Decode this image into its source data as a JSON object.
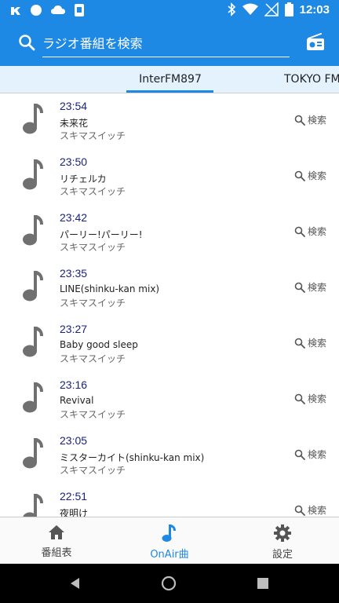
{
  "status_bar": {
    "time": "12:03"
  },
  "search": {
    "placeholder": "ラジオ番組を検索"
  },
  "tabs": [
    {
      "label": "InterFM897"
    },
    {
      "label": "TOKYO FM"
    }
  ],
  "songs": [
    {
      "time": "23:54",
      "title": "未来花",
      "artist": "スキマスイッチ",
      "search_label": "検索"
    },
    {
      "time": "23:50",
      "title": "リチェルカ",
      "artist": "スキマスイッチ",
      "search_label": "検索"
    },
    {
      "time": "23:42",
      "title": "パーリー!パーリー!",
      "artist": "スキマスイッチ",
      "search_label": "検索"
    },
    {
      "time": "23:35",
      "title": "LINE(shinku-kan mix)",
      "artist": "スキマスイッチ",
      "search_label": "検索"
    },
    {
      "time": "23:27",
      "title": "Baby good sleep",
      "artist": "スキマスイッチ",
      "search_label": "検索"
    },
    {
      "time": "23:16",
      "title": "Revival",
      "artist": "スキマスイッチ",
      "search_label": "検索"
    },
    {
      "time": "23:05",
      "title": "ミスターカイト(shinku-kan mix)",
      "artist": "スキマスイッチ",
      "search_label": "検索"
    },
    {
      "time": "22:51",
      "title": "夜明け",
      "artist": "",
      "search_label": "検索"
    }
  ],
  "bottom_nav": [
    {
      "label": "番組表",
      "icon": "home-icon"
    },
    {
      "label": "OnAir曲",
      "icon": "music-note-icon"
    },
    {
      "label": "設定",
      "icon": "gear-icon"
    }
  ],
  "colors": {
    "primary": "#1e88e5",
    "time_text": "#1a237e",
    "tab_bg": "#e3f2fd",
    "icon_gray": "#707070"
  }
}
